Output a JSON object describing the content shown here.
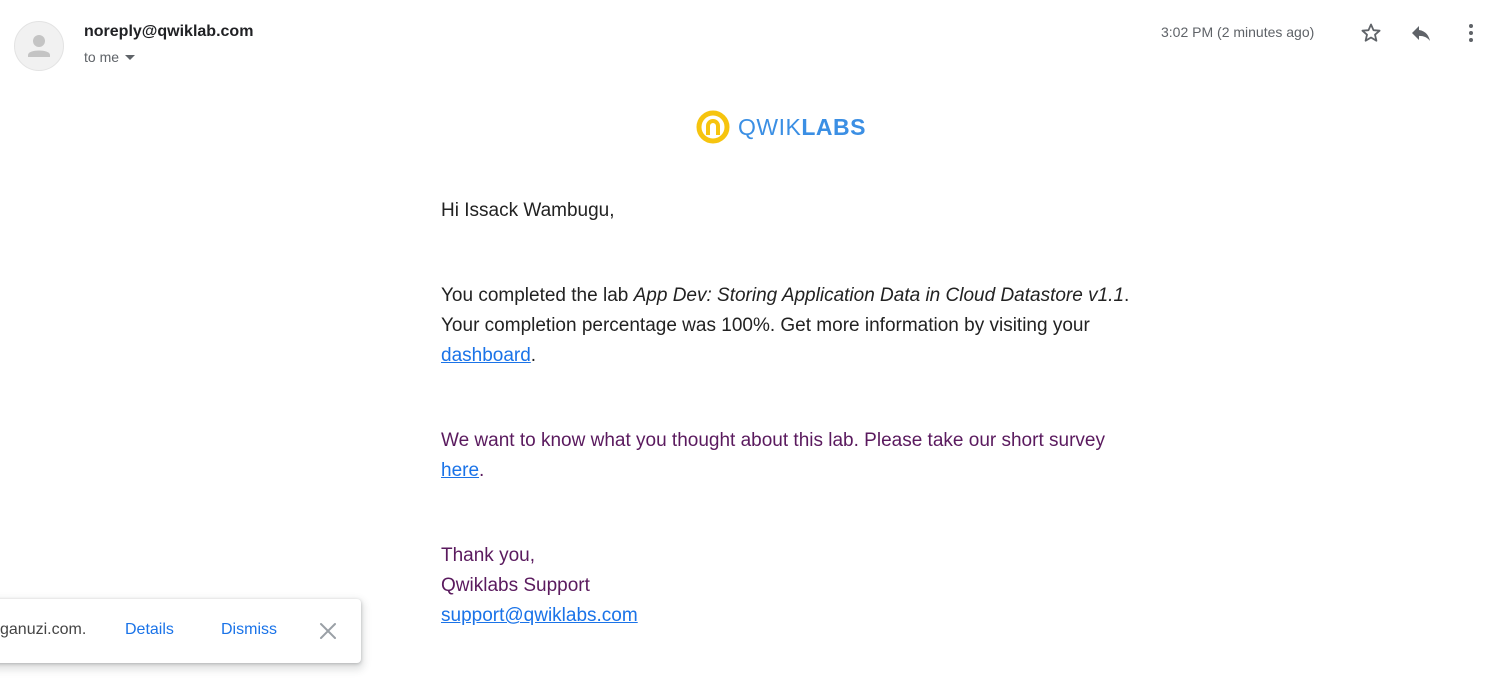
{
  "header": {
    "sender": "noreply@qwiklab.com",
    "recipient_label": "to me",
    "timestamp": "3:02 PM (2 minutes ago)",
    "icons": [
      "person-icon",
      "star-icon",
      "reply-icon",
      "more-vert-icon"
    ]
  },
  "logo": {
    "text_light": "QWIK",
    "text_bold": "LABS",
    "colors": {
      "ring": "#f6c40f",
      "text": "#3b8fe4"
    }
  },
  "email": {
    "greeting": "Hi Issack Wambugu,",
    "completion": {
      "prefix": "You completed the lab ",
      "lab_name": "App Dev: Storing Application Data in Cloud Datastore v1.1",
      "middle": ". Your completion percentage was 100%. Get more information by visiting your ",
      "link_text": "dashboard",
      "suffix": "."
    },
    "survey": {
      "text": "We want to know what you thought about this lab. Please take our short survey ",
      "link_text": "here",
      "suffix": "."
    },
    "signoff": {
      "thanks": "Thank you,",
      "team": "Qwiklabs Support",
      "email_link": "support@qwiklabs.com"
    },
    "colors": {
      "body": "#222222",
      "purple": "#5a1a5e",
      "link": "#1a73e8"
    }
  },
  "snackbar": {
    "message": "ganuzi.com.",
    "details_label": "Details",
    "dismiss_label": "Dismiss",
    "close_icon": "close-icon"
  }
}
